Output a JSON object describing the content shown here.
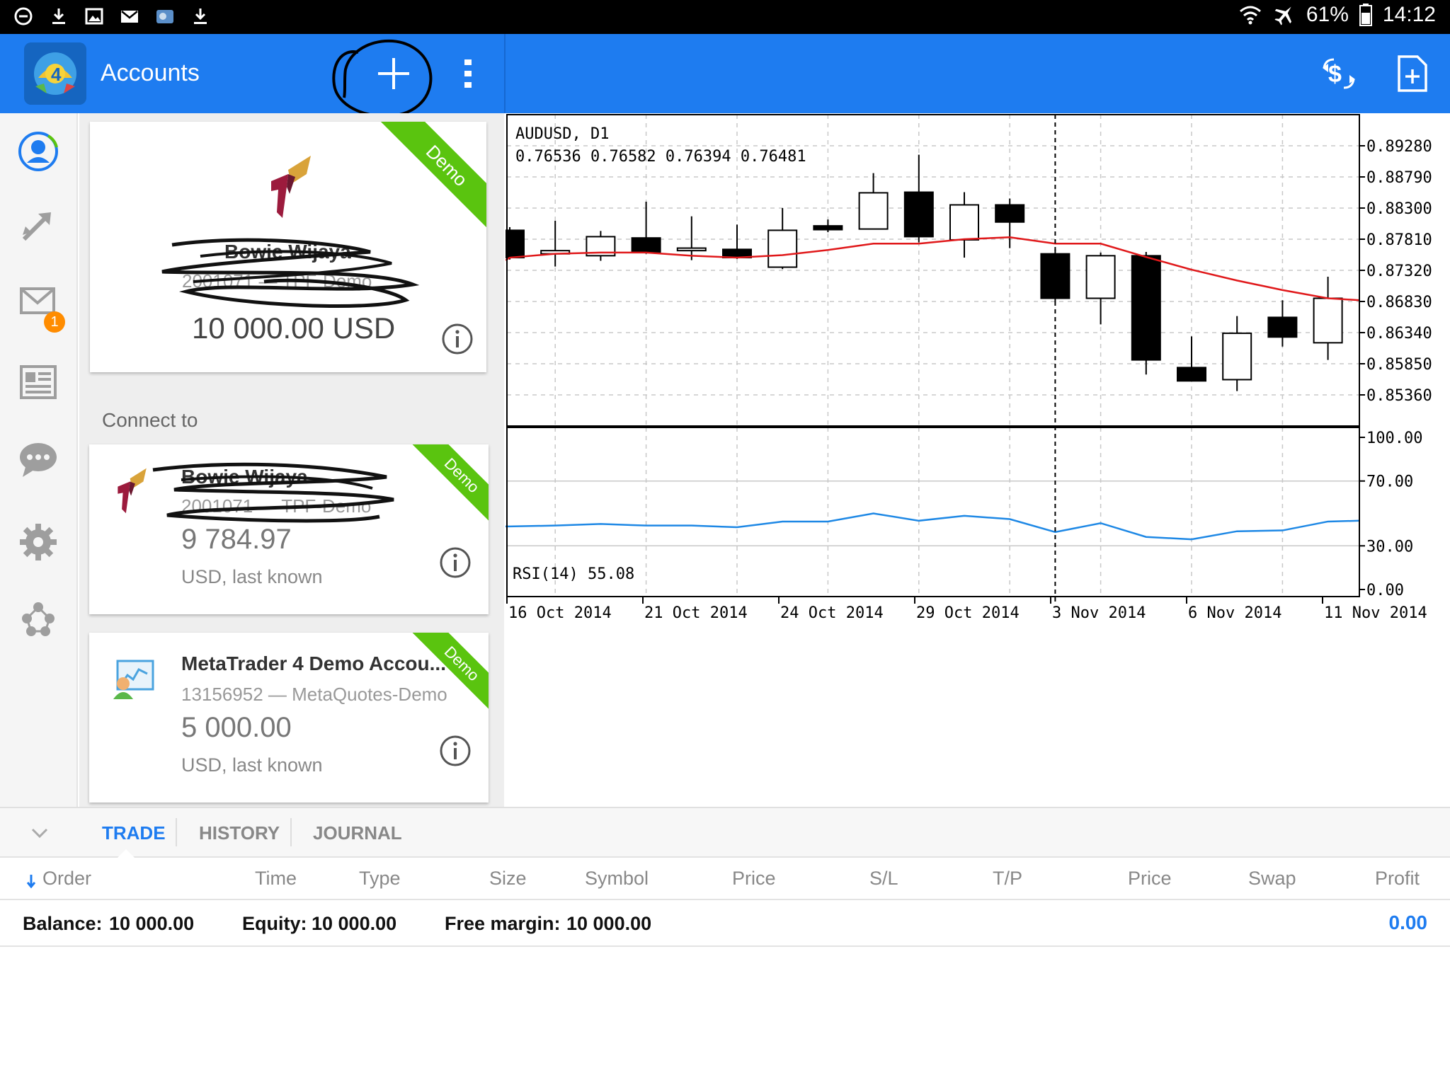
{
  "statusbar": {
    "icons": [
      "minus-circle-icon",
      "download-icon",
      "image-icon",
      "gmail-icon",
      "weather-icon",
      "download-icon"
    ],
    "wifi_icon": "wifi-icon",
    "airplane_icon": "airplane-icon",
    "battery": "61%",
    "time": "14:12"
  },
  "toolbar": {
    "title": "Accounts",
    "accent": "#1e7cf0"
  },
  "sidebar": {
    "items": [
      {
        "name": "accounts",
        "icon": "account-icon"
      },
      {
        "name": "trade",
        "icon": "trade-arrows-icon"
      },
      {
        "name": "mailbox",
        "icon": "mail-icon",
        "badge": "1"
      },
      {
        "name": "news",
        "icon": "news-icon"
      },
      {
        "name": "chat",
        "icon": "chat-icon"
      },
      {
        "name": "settings",
        "icon": "gear-icon"
      },
      {
        "name": "community",
        "icon": "community-icon"
      }
    ]
  },
  "accounts": {
    "active": {
      "name": "Bowie Wijaya",
      "server": "2001071 — TPF-Demo",
      "balance": "10 000.00 USD",
      "ribbon": "Demo"
    },
    "connect_label": "Connect to",
    "others": [
      {
        "name": "Bowie Wijaya",
        "server": "2001071 — TPF-Demo",
        "balance": "9 784.97",
        "currency_note": "USD, last known",
        "ribbon": "Demo"
      },
      {
        "name": "MetaTrader 4 Demo Accou...",
        "server": "13156952 — MetaQuotes-Demo",
        "balance": "5 000.00",
        "currency_note": "USD, last known",
        "ribbon": "Demo"
      }
    ]
  },
  "chart": {
    "symbol_label": "AUDUSD, D1",
    "ohlc_label": "0.76536 0.76582 0.76394 0.76481",
    "rsi_label": "RSI(14) 55.08"
  },
  "chart_data": {
    "type": "candlestick",
    "title": "AUDUSD, D1",
    "price_ticks": [
      "0.89280",
      "0.88790",
      "0.88300",
      "0.87810",
      "0.87320",
      "0.86830",
      "0.86340",
      "0.85850",
      "0.85360"
    ],
    "price_axis_range": [
      0.8487,
      0.8977
    ],
    "date_labels": [
      "16 Oct 2014",
      "21 Oct 2014",
      "24 Oct 2014",
      "29 Oct 2014",
      "3 Nov 2014",
      "6 Nov 2014",
      "11 Nov 2014"
    ],
    "candles": [
      {
        "o": 0.8795,
        "h": 0.88,
        "l": 0.8749,
        "c": 0.8752
      },
      {
        "o": 0.8758,
        "h": 0.881,
        "l": 0.8738,
        "c": 0.8763
      },
      {
        "o": 0.8755,
        "h": 0.8794,
        "l": 0.8747,
        "c": 0.8785
      },
      {
        "o": 0.8783,
        "h": 0.884,
        "l": 0.8758,
        "c": 0.8761
      },
      {
        "o": 0.8763,
        "h": 0.8817,
        "l": 0.8748,
        "c": 0.8767
      },
      {
        "o": 0.8765,
        "h": 0.8804,
        "l": 0.875,
        "c": 0.8752
      },
      {
        "o": 0.8737,
        "h": 0.883,
        "l": 0.8734,
        "c": 0.8795
      },
      {
        "o": 0.8802,
        "h": 0.8812,
        "l": 0.8792,
        "c": 0.8796
      },
      {
        "o": 0.8797,
        "h": 0.8885,
        "l": 0.8797,
        "c": 0.8854
      },
      {
        "o": 0.8855,
        "h": 0.8914,
        "l": 0.8776,
        "c": 0.8785
      },
      {
        "o": 0.878,
        "h": 0.8855,
        "l": 0.8752,
        "c": 0.8835
      },
      {
        "o": 0.8835,
        "h": 0.8845,
        "l": 0.8767,
        "c": 0.8808
      },
      {
        "o": 0.8758,
        "h": 0.8765,
        "l": 0.8682,
        "c": 0.8688
      },
      {
        "o": 0.8688,
        "h": 0.876,
        "l": 0.8647,
        "c": 0.8755
      },
      {
        "o": 0.8755,
        "h": 0.8761,
        "l": 0.8568,
        "c": 0.8591
      },
      {
        "o": 0.8579,
        "h": 0.8628,
        "l": 0.8558,
        "c": 0.8558
      },
      {
        "o": 0.856,
        "h": 0.866,
        "l": 0.8542,
        "c": 0.8633
      },
      {
        "o": 0.8658,
        "h": 0.8685,
        "l": 0.8612,
        "c": 0.8627
      },
      {
        "o": 0.8618,
        "h": 0.8722,
        "l": 0.8591,
        "c": 0.8688
      }
    ],
    "ma_values": [
      0.8752,
      0.8758,
      0.876,
      0.876,
      0.8755,
      0.8752,
      0.8756,
      0.8764,
      0.8774,
      0.8774,
      0.8781,
      0.8784,
      0.8774,
      0.8774,
      0.8753,
      0.8733,
      0.8716,
      0.8701,
      0.8688
    ],
    "ma_color": "#e0181a",
    "rsi_ticks": [
      "100.00",
      "70.00",
      "30.00",
      "0.00"
    ],
    "rsi_range": [
      0,
      100
    ],
    "rsi_values": [
      42,
      42.5,
      43.5,
      42.5,
      42.5,
      41.5,
      45,
      45,
      50,
      45.5,
      48.5,
      46.5,
      38.5,
      44,
      35.5,
      34,
      39,
      39.5,
      45
    ],
    "rsi_color": "#1e88e5",
    "grid": true
  },
  "terminal": {
    "tabs": [
      "TRADE",
      "HISTORY",
      "JOURNAL"
    ],
    "columns": [
      "Order",
      "Time",
      "Type",
      "Size",
      "Symbol",
      "Price",
      "S/L",
      "T/P",
      "Price",
      "Swap",
      "Profit"
    ],
    "summary": {
      "balance_label": "Balance:",
      "balance_value": "10 000.00",
      "equity_label": "Equity:",
      "equity_value": "10 000.00",
      "free_margin_label": "Free margin:",
      "free_margin_value": "10 000.00",
      "profit_total": "0.00"
    }
  }
}
